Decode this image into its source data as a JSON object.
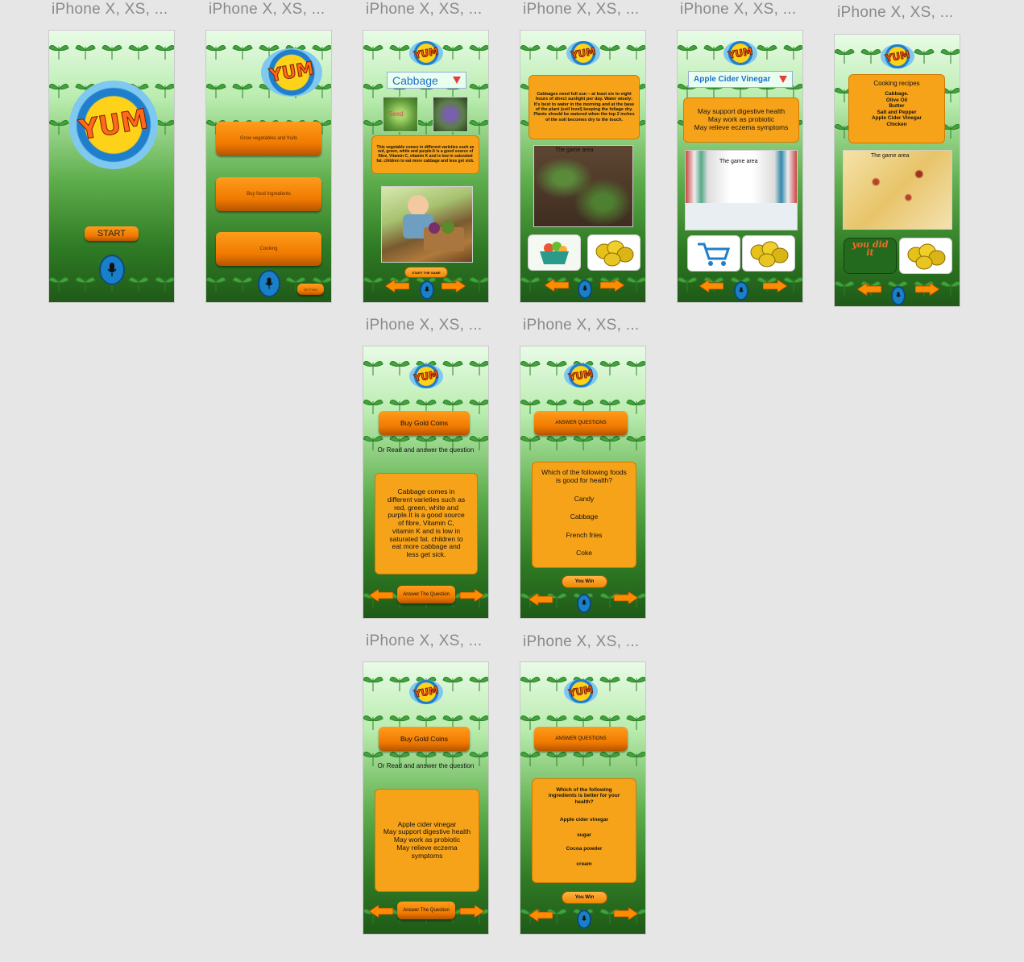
{
  "frame_label": "iPhone X, XS, ...",
  "screens": {
    "s1": {
      "logo": "YUM",
      "start": "START"
    },
    "s2": {
      "logo": "YUM",
      "menu": [
        "Grow vegetables and fruits",
        "Buy food ingredients",
        "Cooking"
      ],
      "setting": "SETTING"
    },
    "s3": {
      "logo": "YUM",
      "dropdown": "Cabbage",
      "seed": "Seed",
      "info": "This vegetable comes in different varieties such as red, green, white and purple.It is a good source of fibre, Vitamin C, vitamin K and is low in saturated fat. children to eat more cabbage and less get sick.",
      "start_game": "START THE GAME"
    },
    "s4": {
      "logo": "YUM",
      "info": "Cabbages need full sun – at least six to eight hours of direct sunlight per day. Water wisely: It's best to water in the morning and at the base of the plant (soil level) keeping the foliage dry. Plants should be watered when the top 2 inches of the soil becomes dry to the touch.",
      "game_area": "The game area"
    },
    "s5": {
      "logo": "YUM",
      "dropdown": "Apple Cider Vinegar",
      "info": [
        "May support digestive health",
        "May work as probiotic",
        "May relieve eczema symptoms"
      ],
      "game_area": "The game area"
    },
    "s6": {
      "logo": "YUM",
      "recipe_title": "Cooking recipes",
      "recipe": [
        "Cabbage.",
        "Olive Oil",
        "Butter",
        "Salt and Pepper",
        "Apple Cider Vinegar",
        "Chicken"
      ],
      "game_area": "The game area",
      "you_did_it": "you did it"
    },
    "s7": {
      "logo": "YUM",
      "buy": "Buy Gold Coins",
      "or_read": "Or Read and answer the question",
      "info": "Cabbage comes in different varieties such as red, green, white and purple.It is a good source of fibre, Vitamin C, vitamin K and is low in saturated fat. children to eat more cabbage and less get sick.",
      "answer": "Answer The Question"
    },
    "s8": {
      "logo": "YUM",
      "header": "ANSWER QUESTIONS",
      "question": "Which of the following foods is good for health?",
      "options": [
        "Candy",
        "Cabbage",
        "French fries",
        "Coke"
      ],
      "win": "You Win"
    },
    "s9": {
      "logo": "YUM",
      "buy": "Buy Gold Coins",
      "or_read": "Or Read and answer the question",
      "info": [
        "Apple cider vinegar",
        "May support digestive health",
        "May work as probiotic",
        "May relieve eczema",
        "symptoms"
      ],
      "answer": "Answer The Question"
    },
    "s10": {
      "logo": "YUM",
      "header": "ANSWER QUESTIONS",
      "question": "Which of the following ingredients is better for your health?",
      "options": [
        "Apple cider vinegar",
        "sugar",
        "Cocoa powder",
        "cream"
      ],
      "win": "You Win"
    }
  },
  "colors": {
    "orange": "#f7a31a",
    "green_dark": "#1f5a18",
    "mic_blue": "#1a7fc9"
  }
}
